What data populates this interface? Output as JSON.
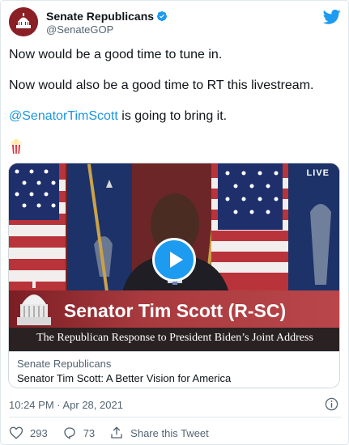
{
  "account": {
    "name": "Senate Republicans",
    "handle": "@SenateGOP",
    "verified": true
  },
  "tweet": {
    "line1": "Now would be a good time to tune in.",
    "line2": "Now would also be a good time to RT this livestream.",
    "mention": "@SenatorTimScott",
    "line3_rest": " is going to bring it.",
    "emoji": "popcorn-icon"
  },
  "media": {
    "live_label": "LIVE",
    "lower_third_title": "Senator Tim Scott (R-SC)",
    "lower_third_subtitle": "The Republican Response to President Biden’s Joint Address",
    "card_source": "Senate Republicans",
    "card_title": "Senator Tim Scott: A Better Vision for America"
  },
  "meta": {
    "timestamp": "10:24 PM · Apr 28, 2021"
  },
  "actions": {
    "likes": "293",
    "replies": "73",
    "share_label": "Share this Tweet"
  },
  "colors": {
    "link": "#1b95e0",
    "play_button": "#1d9bf0",
    "lower_third": "#a83a3e"
  }
}
